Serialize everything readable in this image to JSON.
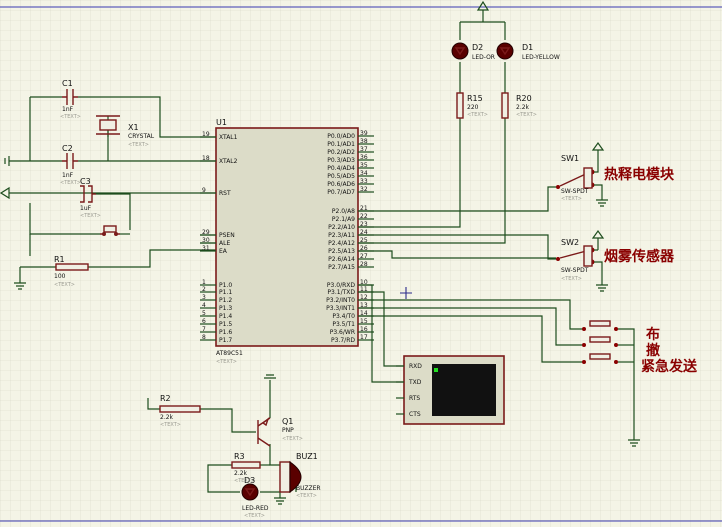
{
  "components": {
    "c1": {
      "ref": "C1",
      "value": "1nF",
      "text": "<TEXT>"
    },
    "c2": {
      "ref": "C2",
      "value": "1nF",
      "text": "<TEXT>"
    },
    "c3": {
      "ref": "C3",
      "value": "1uF",
      "text": "<TEXT>"
    },
    "x1": {
      "ref": "X1",
      "value": "CRYSTAL",
      "text": "<TEXT>"
    },
    "r1": {
      "ref": "R1",
      "value": "100",
      "text": "<TEXT>"
    },
    "r2": {
      "ref": "R2",
      "value": "2.2k",
      "text": "<TEXT>"
    },
    "r3": {
      "ref": "R3",
      "value": "2.2k",
      "text": "<TEXT>"
    },
    "r15": {
      "ref": "R15",
      "value": "220",
      "text": "<TEXT>"
    },
    "r20": {
      "ref": "R20",
      "value": "2.2k",
      "text": "<TEXT>"
    },
    "d1": {
      "ref": "D1",
      "value": "LED-YELLOW"
    },
    "d2": {
      "ref": "D2",
      "value": "LED-OR"
    },
    "d3": {
      "ref": "D3",
      "value": "LED-RED",
      "text": "<TEXT>"
    },
    "q1": {
      "ref": "Q1",
      "value": "PNP",
      "text": "<TEXT>"
    },
    "buz1": {
      "ref": "BUZ1",
      "value": "BUZZER",
      "text": "<TEXT>"
    },
    "sw1": {
      "ref": "SW1",
      "value": "SW-SPDT",
      "text": "<TEXT>"
    },
    "sw2": {
      "ref": "SW2",
      "value": "SW-SPDT",
      "text": "<TEXT>"
    },
    "u1": {
      "ref": "U1",
      "value": "AT89C51",
      "text": "<TEXT>"
    }
  },
  "u1_pins": {
    "left": [
      {
        "num": "19",
        "name": "XTAL1"
      },
      {
        "num": "18",
        "name": "XTAL2"
      },
      {
        "num": "9",
        "name": "RST"
      },
      {
        "num": "29",
        "name": "PSEN"
      },
      {
        "num": "30",
        "name": "ALE"
      },
      {
        "num": "31",
        "name": "EA"
      },
      {
        "num": "1",
        "name": "P1.0"
      },
      {
        "num": "2",
        "name": "P1.1"
      },
      {
        "num": "3",
        "name": "P1.2"
      },
      {
        "num": "4",
        "name": "P1.3"
      },
      {
        "num": "5",
        "name": "P1.4"
      },
      {
        "num": "6",
        "name": "P1.5"
      },
      {
        "num": "7",
        "name": "P1.6"
      },
      {
        "num": "8",
        "name": "P1.7"
      }
    ],
    "right": [
      {
        "num": "39",
        "name": "P0.0/AD0"
      },
      {
        "num": "38",
        "name": "P0.1/AD1"
      },
      {
        "num": "37",
        "name": "P0.2/AD2"
      },
      {
        "num": "36",
        "name": "P0.3/AD3"
      },
      {
        "num": "35",
        "name": "P0.4/AD4"
      },
      {
        "num": "34",
        "name": "P0.5/AD5"
      },
      {
        "num": "33",
        "name": "P0.6/AD6"
      },
      {
        "num": "32",
        "name": "P0.7/AD7"
      },
      {
        "num": "21",
        "name": "P2.0/A8"
      },
      {
        "num": "22",
        "name": "P2.1/A9"
      },
      {
        "num": "23",
        "name": "P2.2/A10"
      },
      {
        "num": "24",
        "name": "P2.3/A11"
      },
      {
        "num": "25",
        "name": "P2.4/A12"
      },
      {
        "num": "26",
        "name": "P2.5/A13"
      },
      {
        "num": "27",
        "name": "P2.6/A14"
      },
      {
        "num": "28",
        "name": "P2.7/A15"
      },
      {
        "num": "10",
        "name": "P3.0/RXD"
      },
      {
        "num": "11",
        "name": "P3.1/TXD"
      },
      {
        "num": "12",
        "name": "P3.2/INT0"
      },
      {
        "num": "13",
        "name": "P3.3/INT1"
      },
      {
        "num": "14",
        "name": "P3.4/T0"
      },
      {
        "num": "15",
        "name": "P3.5/T1"
      },
      {
        "num": "16",
        "name": "P3.6/WR"
      },
      {
        "num": "17",
        "name": "P3.7/RD"
      }
    ]
  },
  "terminal": {
    "pins": [
      "RXD",
      "TXD",
      "RTS",
      "CTS"
    ]
  },
  "labels": {
    "pyro": "热释电模块",
    "smoke": "烟雾传感器",
    "arm1": "布",
    "arm2": "撤",
    "emergency": "紧急发送"
  },
  "colors": {
    "background": "#f4f4e6",
    "wire": "#1d4d1d",
    "component": "#7b1a1a",
    "annotation": "#8a0000"
  }
}
